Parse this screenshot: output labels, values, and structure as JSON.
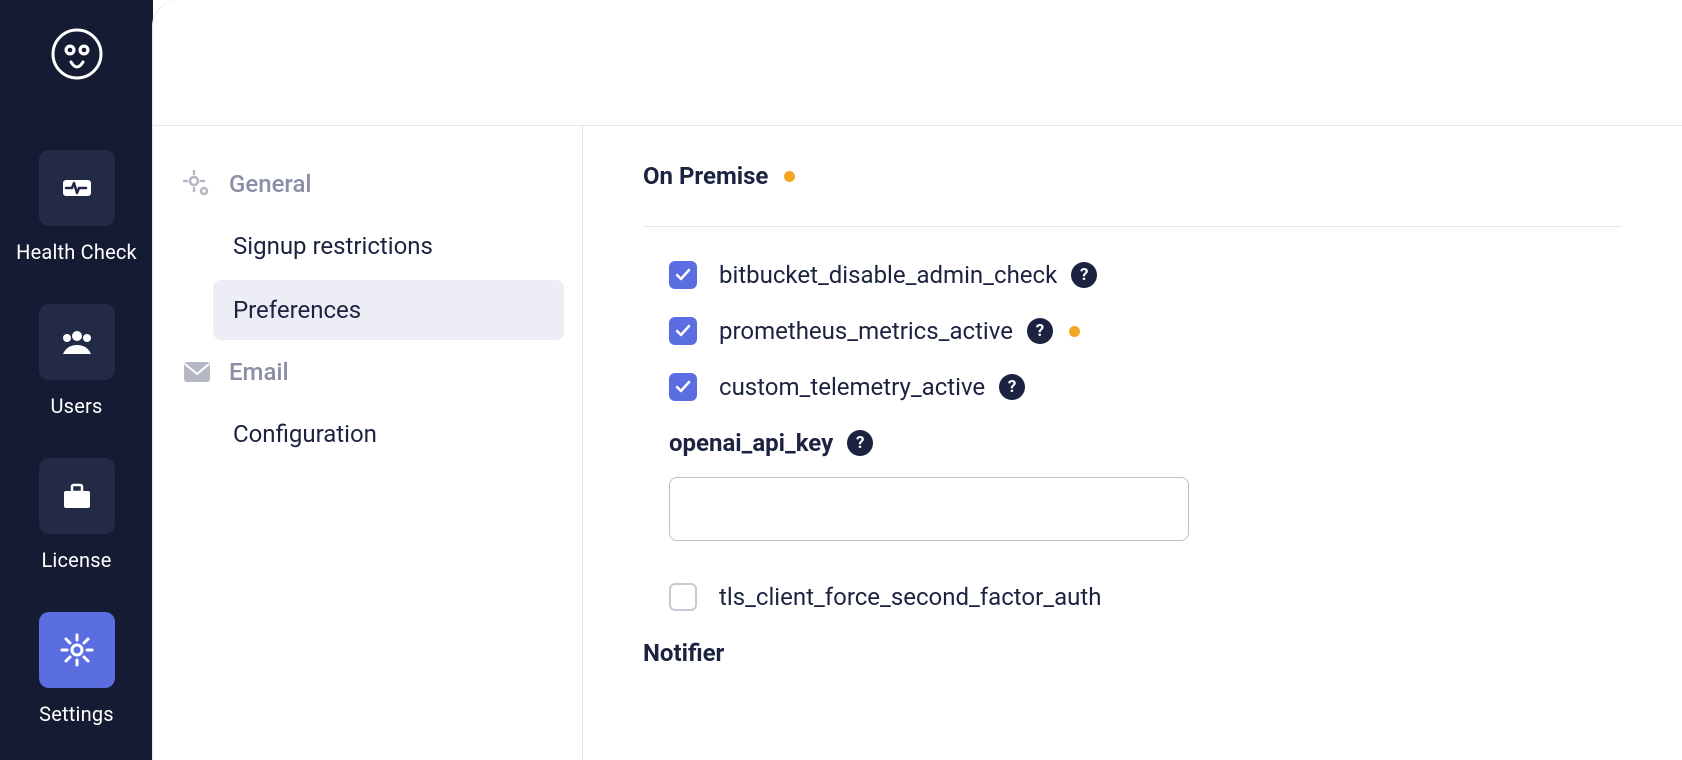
{
  "rail": {
    "items": [
      {
        "id": "health",
        "label": "Health Check",
        "active": false
      },
      {
        "id": "users",
        "label": "Users",
        "active": false
      },
      {
        "id": "license",
        "label": "License",
        "active": false
      },
      {
        "id": "settings",
        "label": "Settings",
        "active": true
      }
    ]
  },
  "subnav": {
    "sections": [
      {
        "id": "general",
        "label": "General",
        "items": [
          {
            "id": "signup",
            "label": "Signup restrictions",
            "active": false
          },
          {
            "id": "preferences",
            "label": "Preferences",
            "active": true
          }
        ]
      },
      {
        "id": "email",
        "label": "Email",
        "items": [
          {
            "id": "configuration",
            "label": "Configuration",
            "active": false
          }
        ]
      }
    ]
  },
  "pane": {
    "onpremise_title": "On Premise",
    "checkboxes": {
      "bitbucket": {
        "label": "bitbucket_disable_admin_check",
        "checked": true,
        "help": true,
        "dot": false
      },
      "prometheus": {
        "label": "prometheus_metrics_active",
        "checked": true,
        "help": true,
        "dot": true
      },
      "telemetry": {
        "label": "custom_telemetry_active",
        "checked": true,
        "help": true,
        "dot": false
      },
      "tls": {
        "label": "tls_client_force_second_factor_auth",
        "checked": false,
        "help": false,
        "dot": false
      }
    },
    "openai": {
      "label": "openai_api_key",
      "value": ""
    },
    "notifier_title": "Notifier"
  }
}
